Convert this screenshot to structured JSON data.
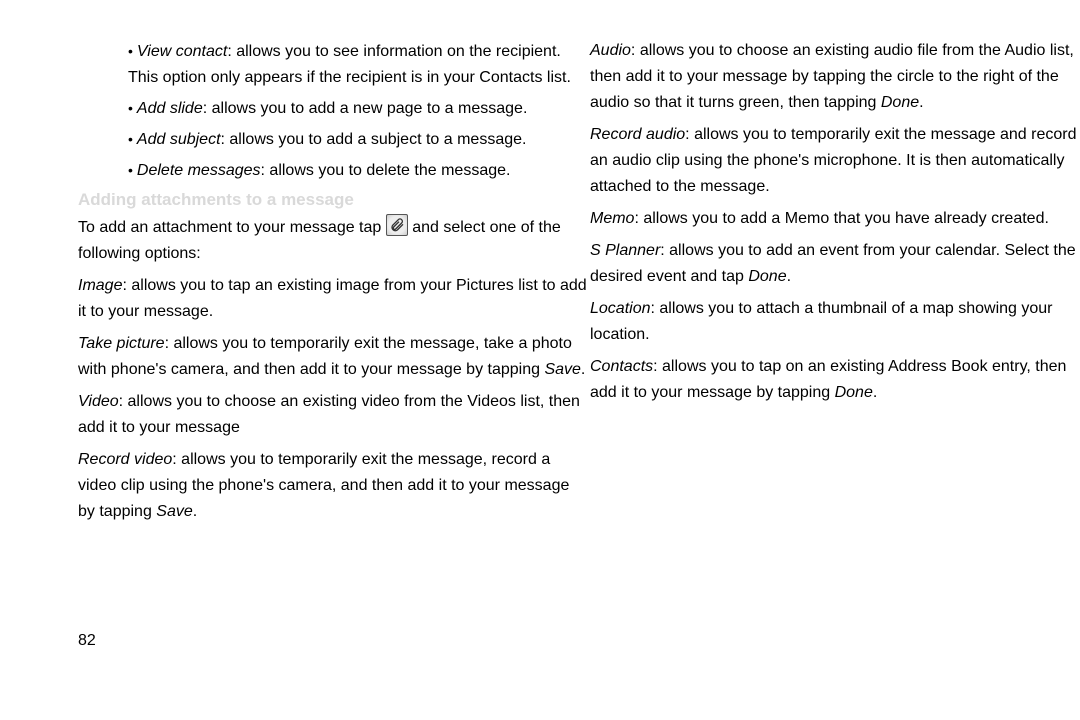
{
  "page_number": "82",
  "left": {
    "items": [
      {
        "term": "View contact",
        "rest": ": allows you to see information on the recipient. This option only appears if the recipient is in your Contacts list."
      },
      {
        "term": "Add slide",
        "rest": ": allows you to add a new page to a message."
      },
      {
        "term": "Add subject",
        "rest": ": allows you to add a subject to a message."
      },
      {
        "term": "Delete messages",
        "rest": ": allows you to delete the message."
      }
    ],
    "heading": "Adding attachments to a message",
    "intro_pre": "To add an attachment to your message tap ",
    "intro_post": " and select one of the following options:",
    "attach": [
      {
        "term": "Image",
        "rest": ": allows you to tap an existing image from your Pictures list to add it to your message."
      },
      {
        "term": "Take picture",
        "rest_pre": ": allows you to temporarily exit the message, take a photo with phone's camera, and then add it to your message by tapping ",
        "term2": "Save",
        "rest_post": "."
      },
      {
        "term": "Video",
        "rest": ": allows you to choose an existing video from the Videos list, then add it to your message"
      },
      {
        "term": "Record video",
        "rest_pre": ": allows you to temporarily exit the message, record a video clip using the phone's camera, and then add it to your message by tapping ",
        "term2": "Save",
        "rest_post": "."
      }
    ]
  },
  "right": {
    "attach": [
      {
        "term": "Audio",
        "rest_pre": ": allows you to choose an existing audio file from the Audio list, then add it to your message by tapping the circle to the right of the audio so that it turns green, then tapping ",
        "term2": "Done",
        "rest_post": "."
      },
      {
        "term": "Record audio",
        "rest": ": allows you to temporarily exit the message and record an audio clip using the phone's microphone. It is then automatically attached to the message."
      },
      {
        "term": "Memo",
        "rest": ": allows you to add a Memo that you have already created."
      },
      {
        "term": "S Planner",
        "rest_pre": ": allows you to add an event from your calendar. Select the desired event and tap ",
        "term2": "Done",
        "rest_post": "."
      },
      {
        "term": "Location",
        "rest": ": allows you to attach a thumbnail of a map showing your location."
      },
      {
        "term": "Contacts",
        "rest_pre": ": allows you to tap on an existing Address Book entry, then add it to your message by tapping ",
        "term2": "Done",
        "rest_post": "."
      }
    ]
  }
}
